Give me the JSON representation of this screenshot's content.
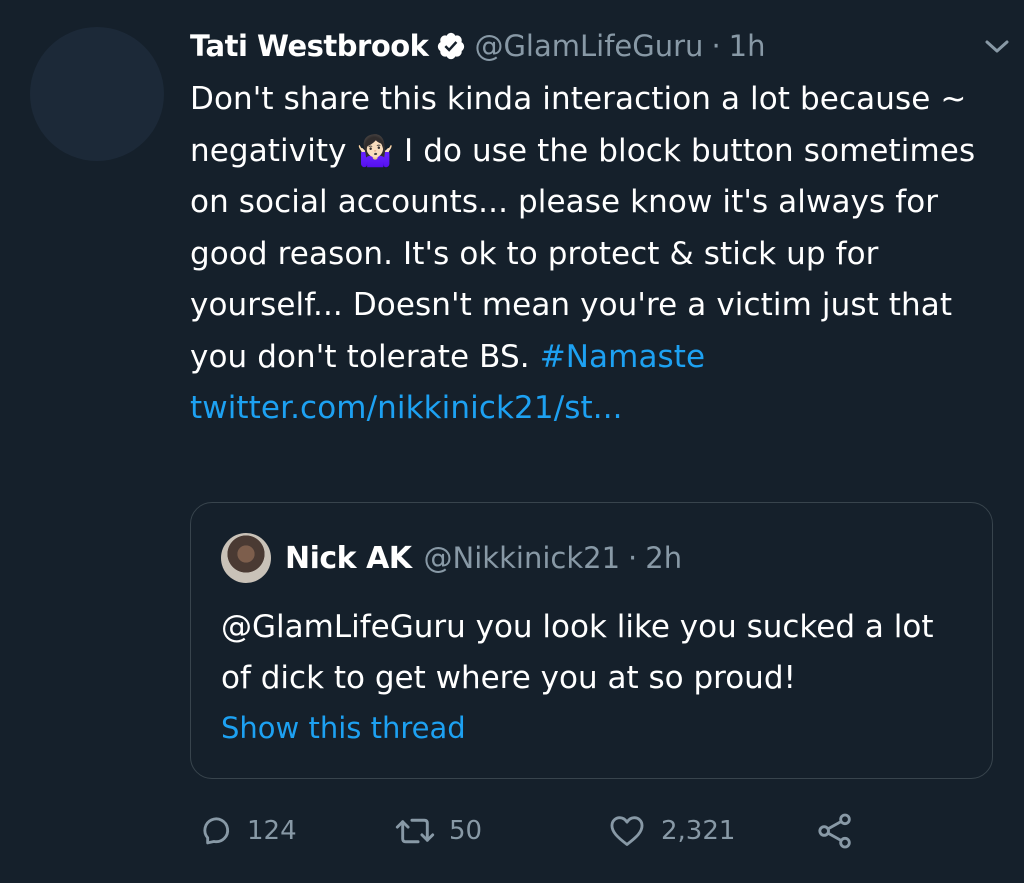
{
  "tweet": {
    "name": "Tati Westbrook",
    "handle": "@GlamLifeGuru",
    "separator": "·",
    "time": "1h",
    "text_before_emoji": "Don't share this kinda interaction a lot because ~ negativity ",
    "emoji": "🤷🏻‍♀️",
    "text_after_emoji": " I do use the block button sometimes on social accounts... please know it's always for good reason. It's ok to protect & stick up for yourself... Doesn't mean you're a victim just that you don't tolerate BS. ",
    "hashtag": "#Namaste",
    "link": "twitter.com/nikkinick21/st..."
  },
  "quote": {
    "name": "Nick AK",
    "handle": "@Nikkinick21",
    "separator": "·",
    "time": "2h",
    "text": "@GlamLifeGuru you look like you sucked a lot of dick to get where you at so proud!",
    "show_thread": "Show this thread"
  },
  "actions": {
    "replies": "124",
    "retweets": "50",
    "likes": "2,321"
  },
  "colors": {
    "background": "#15202b",
    "accent": "#1da1f2",
    "muted": "#8899a6",
    "border": "#38444d"
  },
  "icons": [
    "verified-icon",
    "chevron-down-icon",
    "reply-icon",
    "retweet-icon",
    "like-icon",
    "share-icon"
  ]
}
